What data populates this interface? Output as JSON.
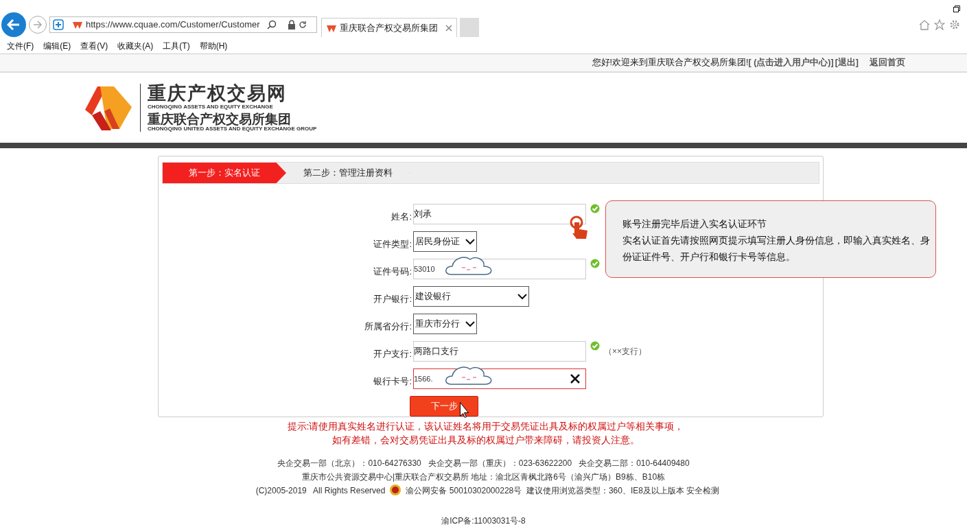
{
  "browser": {
    "url": "https://www.cquae.com/Customer/Customer",
    "tab_title": "重庆联合产权交易所集团",
    "menu": [
      "文件(F)",
      "编辑(E)",
      "查看(V)",
      "收藏夹(A)",
      "工具(T)",
      "帮助(H)"
    ]
  },
  "topbar": {
    "greeting": "您好!欢迎来到重庆联合产权交易所集团!",
    "user_center": "[ (点击进入用户中心)]",
    "logout": "[退出]",
    "home": "返回首页"
  },
  "logo": {
    "title": "重庆产权交易网",
    "title_en": "CHONGQING ASSETS AND EQUITY EXCHANGE",
    "subtitle": "重庆联合产权交易所集团",
    "subtitle_en": "CHONGQING UNITED ASSETS AND EQUITY EXCHANGE GROUP"
  },
  "steps": [
    {
      "label": "第一步：实名认证",
      "selected": true
    },
    {
      "label": "第二步：管理注册资料",
      "selected": false
    }
  ],
  "fields": [
    {
      "kind": "text",
      "label": "姓名:",
      "value": "刘承",
      "verified": true,
      "error": false
    },
    {
      "kind": "select",
      "label": "证件类型:",
      "value": "居民身份证",
      "wide": false
    },
    {
      "kind": "text",
      "label": "证件号码:",
      "value": "53010",
      "verified": true,
      "error": false,
      "masked": true
    },
    {
      "kind": "select",
      "label": "开户银行:",
      "value": "建设银行",
      "wide": true
    },
    {
      "kind": "select",
      "label": "所属省分行:",
      "value": "重庆市分行",
      "wide": false
    },
    {
      "kind": "text",
      "label": "开户支行:",
      "value": "两路口支行",
      "verified": true,
      "error": false,
      "hint": "（××支行）"
    },
    {
      "kind": "text",
      "label": "银行卡号:",
      "value": "1566.",
      "verified": false,
      "error": true,
      "masked": true
    }
  ],
  "next_button": "下一步",
  "callout": [
    "账号注册完毕后进入实名认证环节",
    "实名认证首先请按照网页提示填写注册人身份信息，即输入真实姓名、身份证证件号、开户行和银行卡号等信息。"
  ],
  "notice": [
    "提示:请使用真实姓名进行认证，该认证姓名将用于交易凭证出具及标的权属过户等相关事项，",
    "如有差错，会对交易凭证出具及标的权属过户带来障碍，请投资人注意。"
  ],
  "footer": {
    "line1": "央企交易一部（北京）：010-64276330   央企交易一部（重庆）：023-63622200   央企交易二部：010-64409480",
    "line2": "重庆市公共资源交易中心|重庆联合产权交易所 地址：渝北区青枫北路6号（渝兴广场）B9栋、B10栋",
    "copyright": "(C)2005-2019   All Rights Reserved",
    "record": "渝公网安备 50010302000228号  建议使用浏览器类型：360、IE8及以上版本 安全检测",
    "icp": "渝ICP备:11003031号-8"
  }
}
